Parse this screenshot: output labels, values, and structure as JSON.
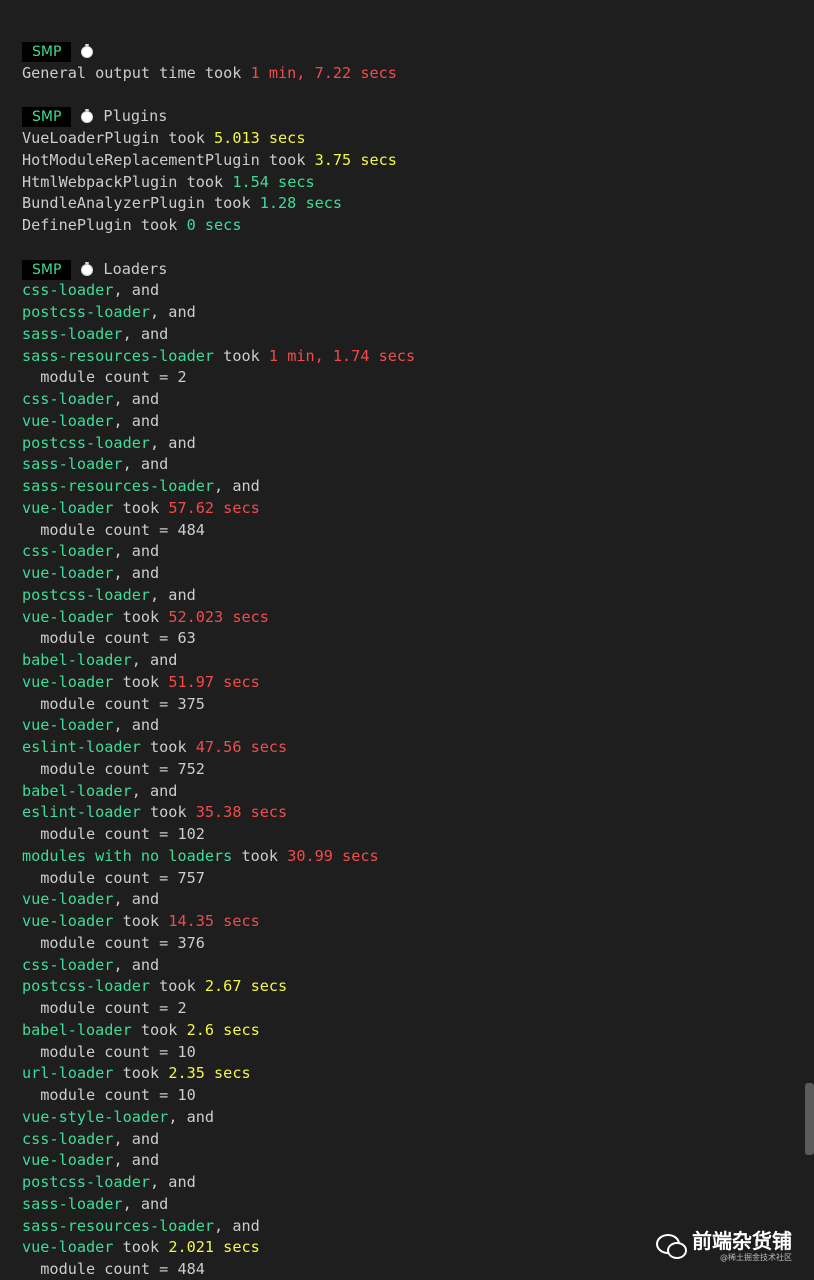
{
  "colors": {
    "background": "#1e1e1e",
    "loader_green": "#3ddc97",
    "slow_red": "#f14c4c",
    "medium_yellow": "#f5f543",
    "text": "#cccccc"
  },
  "sections": {
    "general": {
      "badge": "SMP",
      "title": "",
      "text": "General output time took ",
      "time": "1 min, 7.22 secs"
    },
    "plugins": {
      "badge": "SMP",
      "title": "Plugins",
      "items": [
        {
          "name": "VueLoaderPlugin",
          "took": " took ",
          "time": "5.013 secs"
        },
        {
          "name": "HotModuleReplacementPlugin",
          "took": " took ",
          "time": "3.75 secs"
        },
        {
          "name": "HtmlWebpackPlugin",
          "took": " took ",
          "time": "1.54 secs"
        },
        {
          "name": "BundleAnalyzerPlugin",
          "took": " took ",
          "time": "1.28 secs"
        },
        {
          "name": "DefinePlugin",
          "took": " took ",
          "time": "0 secs"
        }
      ]
    },
    "loaders": {
      "badge": "SMP",
      "title": "Loaders",
      "and_text": ", and",
      "took_text": " took ",
      "count_prefix": "  module count = ",
      "groups": [
        {
          "chain": [
            "css-loader",
            "postcss-loader",
            "sass-loader"
          ],
          "last": "sass-resources-loader",
          "time": "1 min, 1.74 secs",
          "count": "2"
        },
        {
          "chain": [
            "css-loader",
            "vue-loader",
            "postcss-loader",
            "sass-loader",
            "sass-resources-loader"
          ],
          "last": "vue-loader",
          "time": "57.62 secs",
          "count": "484"
        },
        {
          "chain": [
            "css-loader",
            "vue-loader",
            "postcss-loader"
          ],
          "last": "vue-loader",
          "time": "52.023 secs",
          "count": "63"
        },
        {
          "chain": [
            "babel-loader"
          ],
          "last": "vue-loader",
          "time": "51.97 secs",
          "count": "375"
        },
        {
          "chain": [
            "vue-loader"
          ],
          "last": "eslint-loader",
          "time": "47.56 secs",
          "count": "752"
        },
        {
          "chain": [
            "babel-loader"
          ],
          "last": "eslint-loader",
          "time": "35.38 secs",
          "count": "102"
        },
        {
          "chain": [],
          "last": "modules with no loaders",
          "time": "30.99 secs",
          "count": "757"
        },
        {
          "chain": [
            "vue-loader"
          ],
          "last": "vue-loader",
          "time": "14.35 secs",
          "count": "376"
        },
        {
          "chain": [
            "css-loader"
          ],
          "last": "postcss-loader",
          "time": "2.67 secs",
          "count": "2"
        },
        {
          "chain": [],
          "last": "babel-loader",
          "time": "2.6 secs",
          "count": "10"
        },
        {
          "chain": [],
          "last": "url-loader",
          "time": "2.35 secs",
          "count": "10"
        },
        {
          "chain": [
            "vue-style-loader",
            "css-loader",
            "vue-loader",
            "postcss-loader",
            "sass-loader",
            "sass-resources-loader"
          ],
          "last": "vue-loader",
          "time": "2.021 secs",
          "count": "484"
        }
      ]
    }
  },
  "watermark": {
    "name": "前端杂货铺",
    "sub": "@稀土掘金技术社区",
    "logo_icon": "wechat-icon"
  }
}
